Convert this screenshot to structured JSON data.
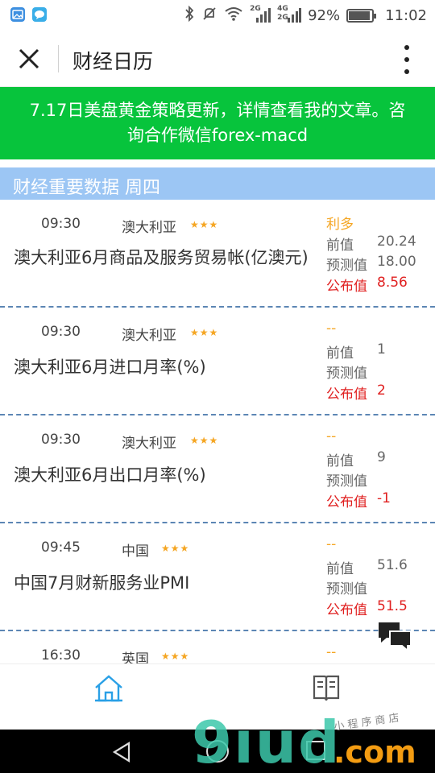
{
  "status_bar": {
    "network_2g": "2G",
    "network_4g": "4G",
    "battery_percent": "92%",
    "battery_level": 0.92,
    "time": "11:02",
    "icons": [
      "gallery-notification-icon",
      "message-notification-icon",
      "bluetooth-icon",
      "mute-icon",
      "wifi-icon",
      "signal-icon",
      "battery-icon"
    ]
  },
  "header": {
    "title": "财经日历",
    "close_icon": "close-icon",
    "more_icon": "more-vertical-icon"
  },
  "banner": {
    "text": "7.17日美盘黄金策略更新，详情查看我的文章。咨询合作微信forex-macd"
  },
  "section": {
    "title": "财经重要数据 周四"
  },
  "labels": {
    "previous": "前值",
    "forecast": "预测值",
    "published": "公布值"
  },
  "events": [
    {
      "time": "09:30",
      "country": "澳大利亚",
      "stars": "★★★",
      "title": "澳大利亚6月商品及服务贸易帐(亿澳元)",
      "impact": "利多",
      "previous": "20.24",
      "forecast": "18.00",
      "published": "8.56"
    },
    {
      "time": "09:30",
      "country": "澳大利亚",
      "stars": "★★★",
      "title": "澳大利亚6月进口月率(%)",
      "impact": "--",
      "previous": "1",
      "forecast": "",
      "published": "2"
    },
    {
      "time": "09:30",
      "country": "澳大利亚",
      "stars": "★★★",
      "title": "澳大利亚6月出口月率(%)",
      "impact": "--",
      "previous": "9",
      "forecast": "",
      "published": "-1"
    },
    {
      "time": "09:45",
      "country": "中国",
      "stars": "★★★",
      "title": "中国7月财新服务业PMI",
      "impact": "--",
      "previous": "51.6",
      "forecast": "",
      "published": "51.5"
    },
    {
      "time": "16:30",
      "country": "英国",
      "stars": "★★★",
      "title": "",
      "impact": "--",
      "previous": "",
      "forecast": "",
      "published": ""
    }
  ],
  "bottom_nav": {
    "home_icon": "home-icon",
    "calendar_icon": "book-icon"
  },
  "colors": {
    "banner_bg": "#07c43c",
    "section_bg": "#9cc6f4",
    "impact_orange": "#f5a623",
    "published_red": "#e02020",
    "divider_blue": "#5c86b4"
  }
}
